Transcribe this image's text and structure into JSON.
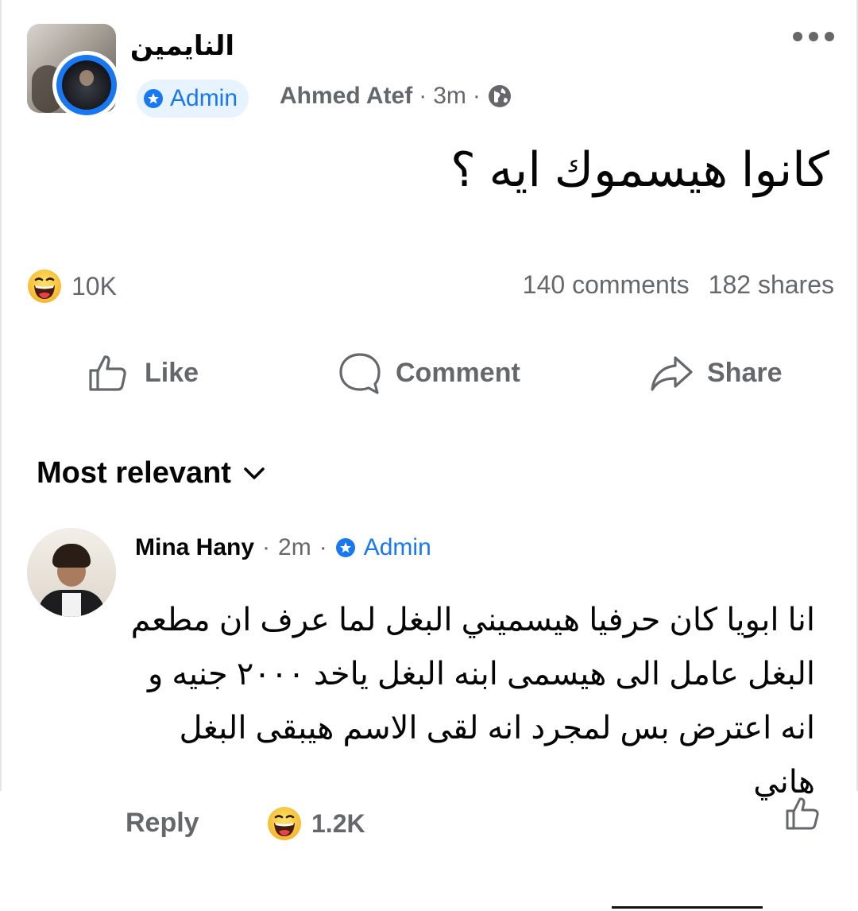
{
  "post": {
    "group_name": "النايمين",
    "badge": "Admin",
    "author": "Ahmed Atef",
    "separator": "·",
    "time": "3m",
    "text": "كانوا هيسموك ايه ؟",
    "reaction_count": "10K",
    "comments": "140 comments",
    "shares": "182 shares"
  },
  "actions": {
    "like": "Like",
    "comment": "Comment",
    "share": "Share"
  },
  "sort": {
    "label": "Most relevant"
  },
  "comment": {
    "author": "Mina Hany",
    "time": "2m",
    "badge": "Admin",
    "separator": "·",
    "text": "انا ابويا كان حرفيا هيسميني البغل لما عرف ان مطعم البغل عامل الى هيسمى ابنه البغل ياخد ٢٠٠٠ جنيه و انه اعترض بس لمجرد انه لقى الاسم هيبقى البغل هاني",
    "reply_label": "Reply",
    "reaction_count": "1.2K"
  },
  "colors": {
    "accent": "#1877f2",
    "muted": "#65676b",
    "text": "#050505"
  },
  "icons": [
    "more-icon",
    "globe-icon",
    "admin-badge-icon",
    "haha-icon",
    "like-icon",
    "comment-icon",
    "share-icon",
    "chevron-down-icon"
  ]
}
